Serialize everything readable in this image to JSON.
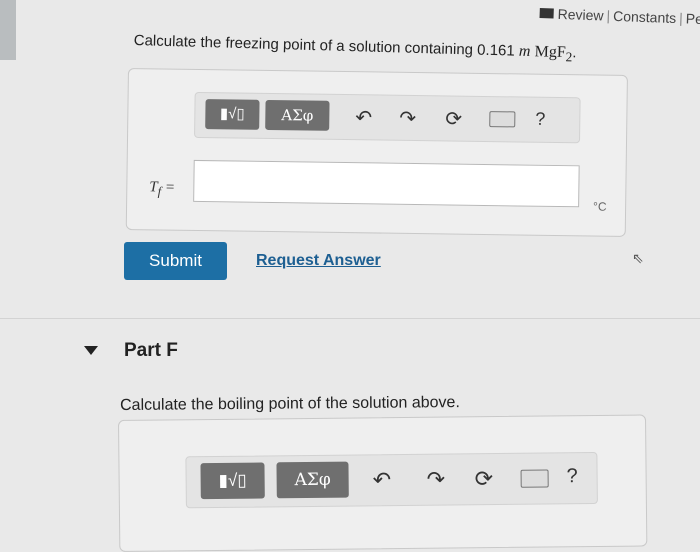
{
  "header": {
    "review_label": "Review",
    "constants_label": "Constants",
    "periodic_label": "Pe",
    "separator": "|"
  },
  "part_e": {
    "question_prefix": "Calculate the freezing point of a solution containing 0.161 ",
    "molality_unit": "m",
    "compound": "MgF",
    "subscript": "2",
    "question_suffix": ".",
    "toolbar": {
      "template_label": "▮√▯",
      "greek_label": "ΑΣφ",
      "undo_symbol": "↶",
      "redo_symbol": "↷",
      "reset_symbol": "⟳",
      "help_symbol": "?"
    },
    "answer_label": "T",
    "answer_label_sub": "f",
    "answer_label_eq": " =",
    "answer_value": "",
    "unit": "°C",
    "submit_label": "Submit",
    "request_label": "Request Answer"
  },
  "part_f": {
    "title": "Part F",
    "question": "Calculate the boiling point of the solution above.",
    "toolbar": {
      "template_label": "▮√▯",
      "greek_label": "ΑΣφ",
      "undo_symbol": "↶",
      "redo_symbol": "↷",
      "reset_symbol": "⟳",
      "help_symbol": "?"
    }
  },
  "colors": {
    "submit_bg": "#1d6fa5",
    "link": "#1d5f92",
    "toolbar_btn": "#6f6f6f"
  }
}
